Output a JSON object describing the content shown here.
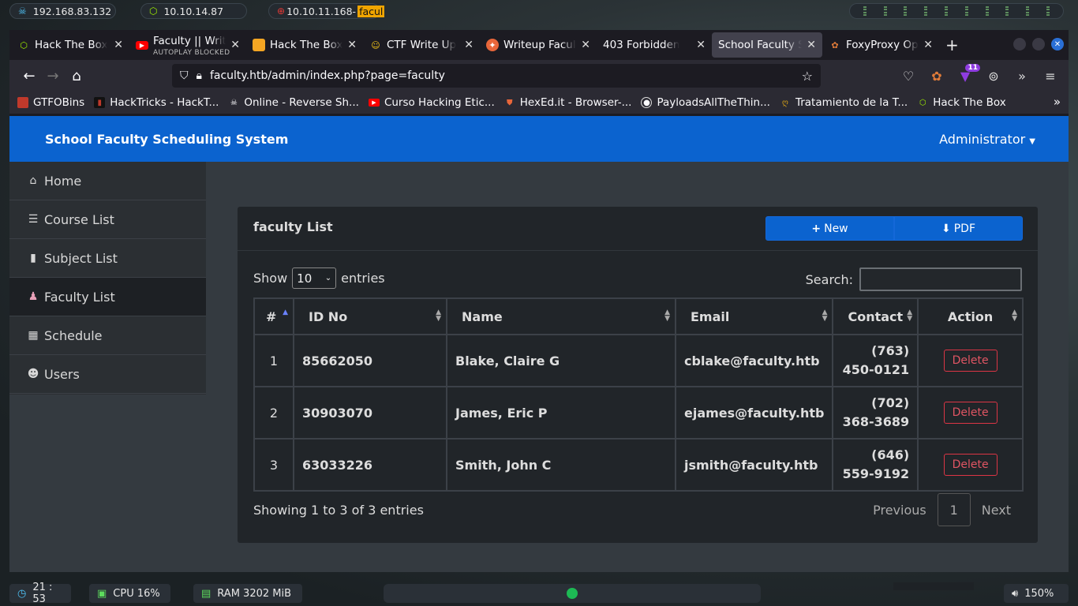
{
  "topbar": {
    "ip1": "192.168.83.132",
    "ip2": "10.10.14.87",
    "ip3": "10.10.11.168-",
    "ip3_tail": "facul"
  },
  "tabs": [
    {
      "label": "Hack The Box",
      "icon": "hackthebox-icon",
      "color": "#9fef00"
    },
    {
      "label": "Faculty || Writ",
      "sub": "AUTOPLAY BLOCKED",
      "icon": "youtube-icon",
      "color": "#ff0000"
    },
    {
      "label": "Hack The Box",
      "icon": "folder-icon",
      "color": "#f5a623"
    },
    {
      "label": "CTF Write Up",
      "icon": "cat-icon",
      "color": "#f5c518"
    },
    {
      "label": "Writeup Facul",
      "icon": "writeup-icon",
      "color": "#e8663a"
    },
    {
      "label": "403 Forbidden",
      "icon": "",
      "color": ""
    },
    {
      "label": "School Faculty Sc",
      "icon": "",
      "color": "",
      "active": true
    },
    {
      "label": "FoxyProxy Opt",
      "icon": "foxyproxy-icon",
      "color": "#e07b39"
    }
  ],
  "url": "faculty.htb/admin/index.php?page=faculty",
  "extension_badge": "11",
  "bookmarks": [
    {
      "label": "GTFOBins",
      "color": "#c0392b"
    },
    {
      "label": "HackTricks - HackT...",
      "color": "#c0392b"
    },
    {
      "label": "Online - Reverse Sh...",
      "color": "#ddd"
    },
    {
      "label": "Curso Hacking Etic...",
      "color": "#ff0000"
    },
    {
      "label": "HexEd.it - Browser-...",
      "color": "#e8663a"
    },
    {
      "label": "PayloadsAllTheThin...",
      "color": "#ddd"
    },
    {
      "label": "Tratamiento de la T...",
      "color": "#d4a017"
    },
    {
      "label": "Hack The Box",
      "color": "#9fef00"
    }
  ],
  "app": {
    "title": "School Faculty Scheduling System",
    "user": "Administrator"
  },
  "sidebar": [
    {
      "label": "Home",
      "icon": "home-icon",
      "glyph": "⌂"
    },
    {
      "label": "Course List",
      "icon": "list-icon",
      "glyph": "☰"
    },
    {
      "label": "Subject List",
      "icon": "book-icon",
      "glyph": "▮"
    },
    {
      "label": "Faculty List",
      "icon": "user-tie-icon",
      "glyph": "♟",
      "active": true
    },
    {
      "label": "Schedule",
      "icon": "calendar-icon",
      "glyph": "▦"
    },
    {
      "label": "Users",
      "icon": "users-icon",
      "glyph": "☻"
    }
  ],
  "card": {
    "title": "faculty List",
    "new_label": "New",
    "pdf_label": "PDF",
    "show_label": "Show",
    "entries_label": "entries",
    "page_length": "10",
    "search_label": "Search:",
    "columns": [
      "#",
      "ID No",
      "Name",
      "Email",
      "Contact",
      "Action"
    ],
    "rows": [
      {
        "num": "1",
        "id": "85662050",
        "name": "Blake, Claire G",
        "email": "cblake@faculty.htb",
        "contact1": "(763)",
        "contact2": "450-0121",
        "action": "Delete"
      },
      {
        "num": "2",
        "id": "30903070",
        "name": "James, Eric P",
        "email": "ejames@faculty.htb",
        "contact1": "(702)",
        "contact2": "368-3689",
        "action": "Delete"
      },
      {
        "num": "3",
        "id": "63033226",
        "name": "Smith, John C",
        "email": "jsmith@faculty.htb",
        "contact1": "(646)",
        "contact2": "559-9192",
        "action": "Delete"
      }
    ],
    "info": "Showing 1 to 3 of 3 entries",
    "previous": "Previous",
    "page": "1",
    "next": "Next"
  },
  "bottombar": {
    "time": "21 : 53",
    "cpu": "CPU 16%",
    "ram": "RAM 3202 MiB",
    "volume": "150%"
  }
}
